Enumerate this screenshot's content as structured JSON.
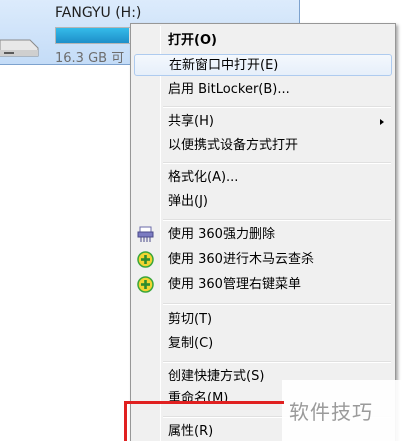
{
  "drive": {
    "name": "FANGYU (H:)",
    "free_text": "16.3 GB 可",
    "usage_fraction": 0.3,
    "bar_color": "#26a4da"
  },
  "context_menu": {
    "items": [
      {
        "label": "打开(O)",
        "bold": true
      },
      {
        "label": "在新窗口中打开(E)",
        "hover": true
      },
      {
        "label": "启用 BitLocker(B)..."
      },
      {
        "label": "共享(H)",
        "submenu": true
      },
      {
        "label": "以便携式设备方式打开"
      },
      {
        "label": "格式化(A)..."
      },
      {
        "label": "弹出(J)"
      },
      {
        "label": "使用 360强力删除",
        "icon": "shredder-icon"
      },
      {
        "label": "使用 360进行木马云查杀",
        "icon": "plus-shield-icon"
      },
      {
        "label": "使用 360管理右键菜单",
        "icon": "plus-shield-icon"
      },
      {
        "label": "剪切(T)"
      },
      {
        "label": "复制(C)"
      },
      {
        "label": "创建快捷方式(S)"
      },
      {
        "label": "重命名(M)"
      },
      {
        "label": "属性(R)"
      }
    ]
  },
  "watermark": "软件技巧",
  "colors": {
    "menu_bg": "#f0f0f0",
    "hover_border": "#aecbef",
    "highlight_box": "#e02020",
    "icon_green": "#3aa63a",
    "icon_yellow": "#f2d531"
  }
}
